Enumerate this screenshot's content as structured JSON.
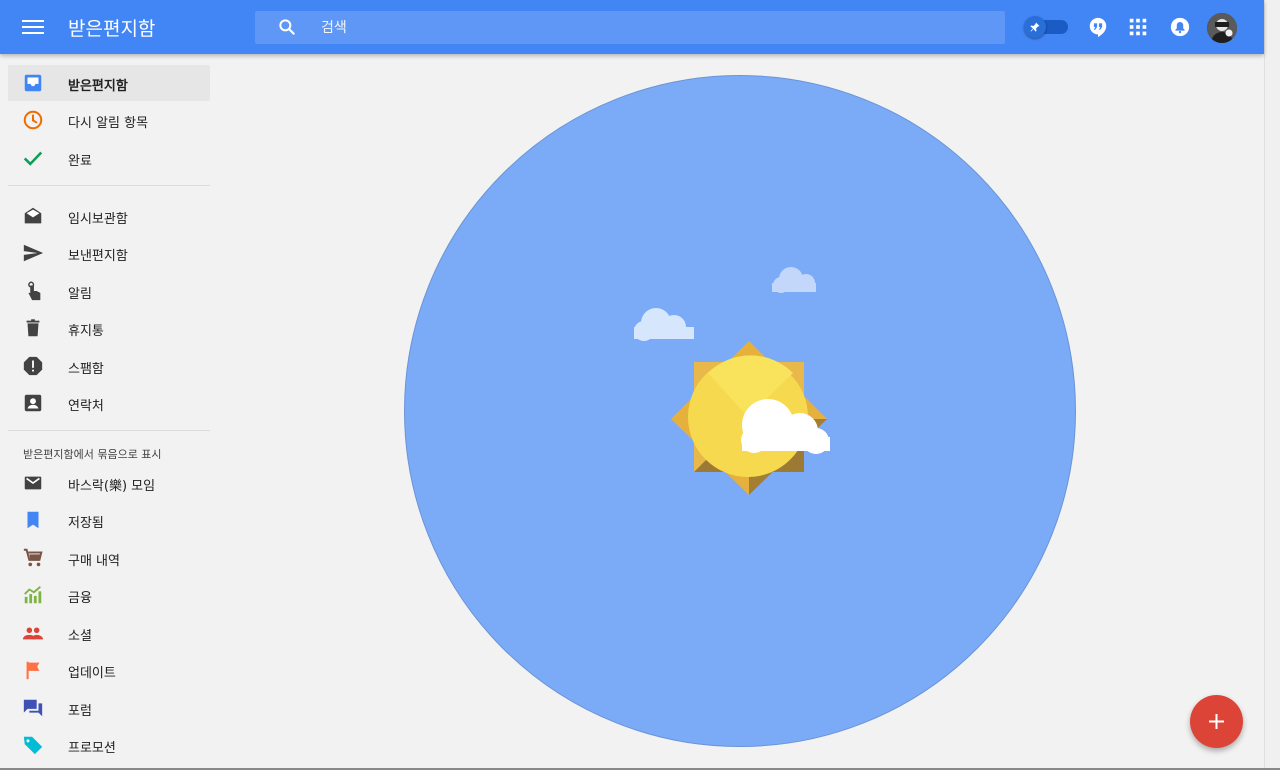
{
  "header": {
    "title": "받은편지함",
    "search_placeholder": "검색",
    "icons": [
      "menu-icon",
      "search-icon",
      "pin-icon",
      "hangouts-icon",
      "apps-grid-icon",
      "notifications-icon",
      "avatar"
    ]
  },
  "sidebar": {
    "primary": [
      {
        "label": "받은편지함",
        "icon": "inbox-icon",
        "active": true
      },
      {
        "label": "다시 알림 항목",
        "icon": "clock-icon"
      },
      {
        "label": "완료",
        "icon": "check-icon"
      }
    ],
    "secondary": [
      {
        "label": "임시보관함",
        "icon": "drafts-icon"
      },
      {
        "label": "보낸편지함",
        "icon": "send-icon"
      },
      {
        "label": "알림",
        "icon": "reminder-icon"
      },
      {
        "label": "휴지통",
        "icon": "trash-icon"
      },
      {
        "label": "스팸함",
        "icon": "spam-icon"
      },
      {
        "label": "연락처",
        "icon": "contacts-icon"
      }
    ],
    "bundles_title": "받은편지함에서 묶음으로 표시",
    "bundles": [
      {
        "label": "바스락(樂) 모임",
        "icon": "mail-icon"
      },
      {
        "label": "저장됨",
        "icon": "bookmark-icon"
      },
      {
        "label": "구매 내역",
        "icon": "cart-icon"
      },
      {
        "label": "금융",
        "icon": "finance-icon"
      },
      {
        "label": "소셜",
        "icon": "people-icon"
      },
      {
        "label": "업데이트",
        "icon": "flag-icon"
      },
      {
        "label": "포럼",
        "icon": "forum-icon"
      },
      {
        "label": "프로모션",
        "icon": "tag-icon"
      }
    ]
  },
  "colors": {
    "primary": "#4285f4",
    "search_bg": "#5e97f6",
    "hero": "#7baaf7",
    "fab": "#db4437"
  }
}
